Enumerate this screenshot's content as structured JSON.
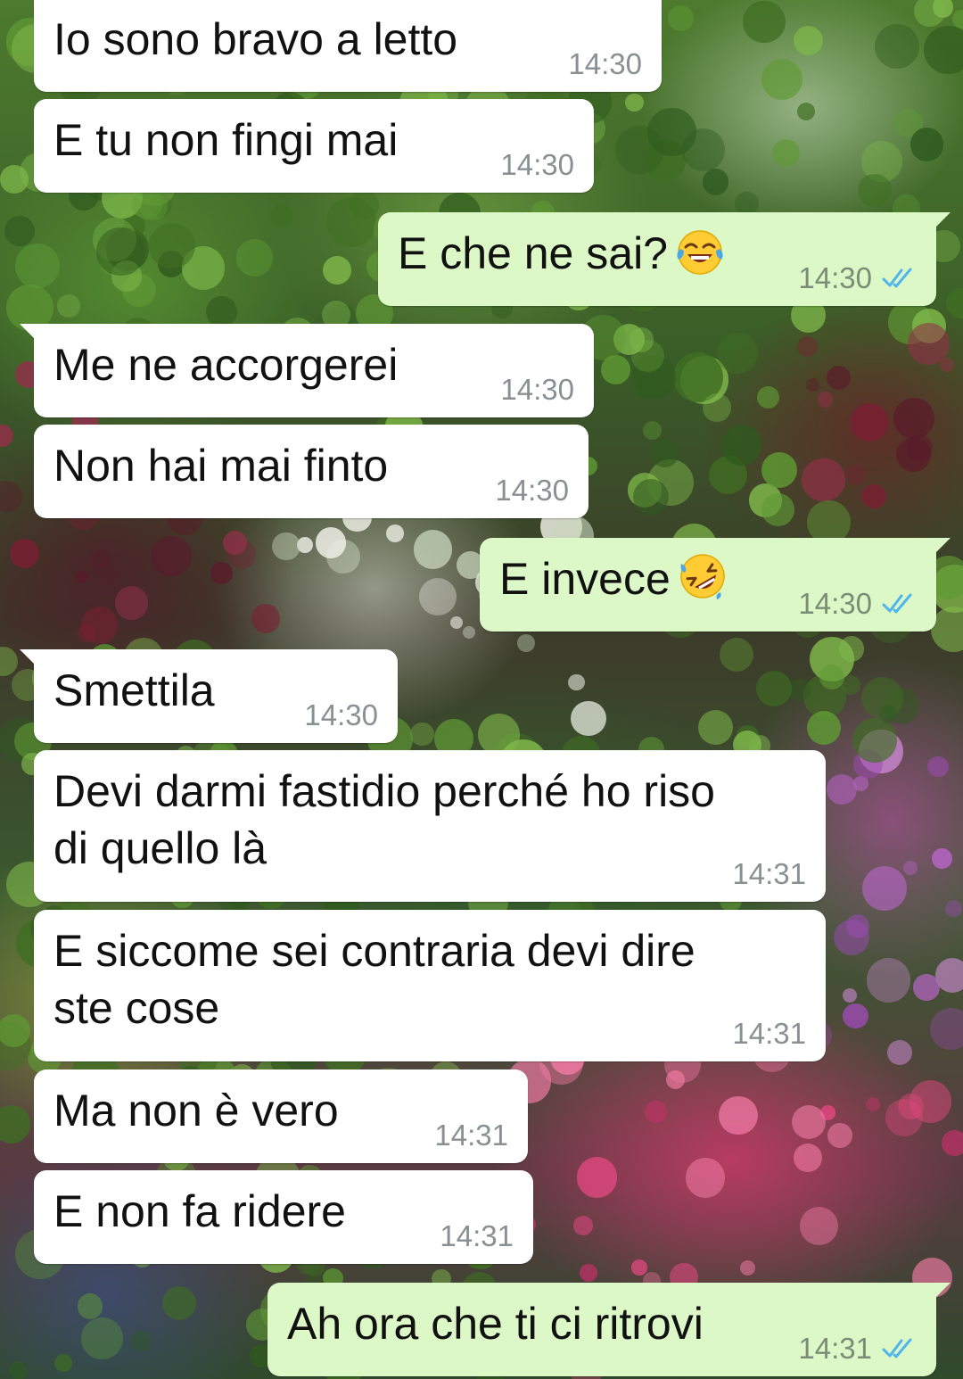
{
  "colors": {
    "incoming_bubble": "#ffffff",
    "outgoing_bubble": "#dcf8c6",
    "timestamp": "#8a8f93",
    "read_ticks": "#4fb6ec"
  },
  "messages": [
    {
      "direction": "incoming",
      "text": "Io sono bravo a letto",
      "time": "14:30"
    },
    {
      "direction": "incoming",
      "text": "E tu non fingi mai",
      "time": "14:30"
    },
    {
      "direction": "outgoing",
      "text": "E che ne sai?",
      "emoji": "face-with-tears-of-joy",
      "time": "14:30",
      "status": "read"
    },
    {
      "direction": "incoming",
      "text": "Me ne accorgerei",
      "time": "14:30"
    },
    {
      "direction": "incoming",
      "text": "Non hai mai finto",
      "time": "14:30"
    },
    {
      "direction": "outgoing",
      "text": "E invece",
      "emoji": "rolling-on-the-floor-laughing",
      "time": "14:30",
      "status": "read"
    },
    {
      "direction": "incoming",
      "text": "Smettila",
      "time": "14:30"
    },
    {
      "direction": "incoming",
      "text": "Devi darmi fastidio perché ho riso\ndi quello là",
      "time": "14:31"
    },
    {
      "direction": "incoming",
      "text": "E siccome sei contraria devi dire\nste cose",
      "time": "14:31"
    },
    {
      "direction": "incoming",
      "text": "Ma non è vero",
      "time": "14:31"
    },
    {
      "direction": "incoming",
      "text": "E non fa ridere",
      "time": "14:31"
    },
    {
      "direction": "outgoing",
      "text": "Ah ora che ti ci ritrovi",
      "time": "14:31",
      "status": "read"
    }
  ]
}
